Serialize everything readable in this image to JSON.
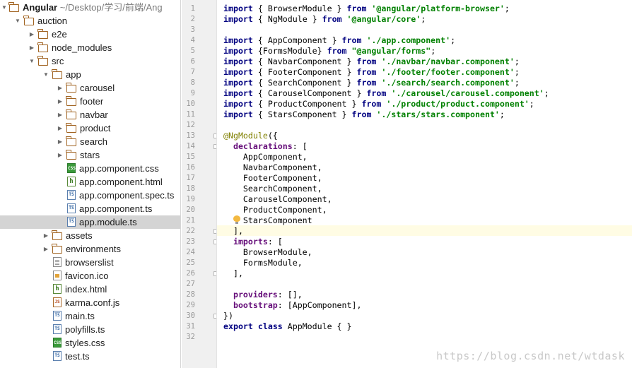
{
  "tree": {
    "project_name": "Angular",
    "project_path": " ~/Desktop/学习/前端/Ang",
    "items": [
      {
        "label": "auction",
        "type": "folder",
        "expanded": true
      },
      {
        "label": "e2e",
        "type": "folder",
        "expanded": false
      },
      {
        "label": "node_modules",
        "type": "folder",
        "expanded": false
      },
      {
        "label": "src",
        "type": "folder",
        "expanded": true
      },
      {
        "label": "app",
        "type": "folder",
        "expanded": true
      },
      {
        "label": "carousel",
        "type": "folder",
        "expanded": false
      },
      {
        "label": "footer",
        "type": "folder",
        "expanded": false
      },
      {
        "label": "navbar",
        "type": "folder",
        "expanded": false
      },
      {
        "label": "product",
        "type": "folder",
        "expanded": false
      },
      {
        "label": "search",
        "type": "folder",
        "expanded": false
      },
      {
        "label": "stars",
        "type": "folder",
        "expanded": false
      },
      {
        "label": "app.component.css",
        "type": "css"
      },
      {
        "label": "app.component.html",
        "type": "html"
      },
      {
        "label": "app.component.spec.ts",
        "type": "ts"
      },
      {
        "label": "app.component.ts",
        "type": "ts"
      },
      {
        "label": "app.module.ts",
        "type": "ts",
        "selected": true
      },
      {
        "label": "assets",
        "type": "folder",
        "expanded": false
      },
      {
        "label": "environments",
        "type": "folder",
        "expanded": false
      },
      {
        "label": "browserslist",
        "type": "plain"
      },
      {
        "label": "favicon.ico",
        "type": "ico"
      },
      {
        "label": "index.html",
        "type": "html"
      },
      {
        "label": "karma.conf.js",
        "type": "js"
      },
      {
        "label": "main.ts",
        "type": "ts"
      },
      {
        "label": "polyfills.ts",
        "type": "ts"
      },
      {
        "label": "styles.css",
        "type": "css"
      },
      {
        "label": "test.ts",
        "type": "ts"
      }
    ]
  },
  "icons": {
    "folder": "folder-icon",
    "css": "css-file-icon",
    "html": "html-file-icon",
    "ts": "typescript-file-icon",
    "js": "javascript-file-icon",
    "plain": "text-file-icon",
    "ico": "image-file-icon",
    "intention": "lightbulb-icon"
  },
  "editor": {
    "current_line": 22,
    "lines": [
      [
        [
          "import",
          "kw"
        ],
        [
          " { BrowserModule } ",
          ""
        ],
        [
          "from",
          "kw"
        ],
        [
          " ",
          ""
        ],
        [
          "'@angular/platform-browser'",
          "str"
        ],
        [
          ";",
          ""
        ]
      ],
      [
        [
          "import",
          "kw"
        ],
        [
          " { NgModule } ",
          ""
        ],
        [
          "from",
          "kw"
        ],
        [
          " ",
          ""
        ],
        [
          "'@angular/core'",
          "str"
        ],
        [
          ";",
          ""
        ]
      ],
      [],
      [
        [
          "import",
          "kw"
        ],
        [
          " { AppComponent } ",
          ""
        ],
        [
          "from",
          "kw"
        ],
        [
          " ",
          ""
        ],
        [
          "'./app.component'",
          "str"
        ],
        [
          ";",
          ""
        ]
      ],
      [
        [
          "import",
          "kw"
        ],
        [
          " {FormsModule} ",
          ""
        ],
        [
          "from",
          "kw"
        ],
        [
          " ",
          ""
        ],
        [
          "\"@angular/forms\"",
          "str"
        ],
        [
          ";",
          ""
        ]
      ],
      [
        [
          "import",
          "kw"
        ],
        [
          " { NavbarComponent } ",
          ""
        ],
        [
          "from",
          "kw"
        ],
        [
          " ",
          ""
        ],
        [
          "'./navbar/navbar.component'",
          "str"
        ],
        [
          ";",
          ""
        ]
      ],
      [
        [
          "import",
          "kw"
        ],
        [
          " { FooterComponent } ",
          ""
        ],
        [
          "from",
          "kw"
        ],
        [
          " ",
          ""
        ],
        [
          "'./footer/footer.component'",
          "str"
        ],
        [
          ";",
          ""
        ]
      ],
      [
        [
          "import",
          "kw"
        ],
        [
          " { SearchComponent } ",
          ""
        ],
        [
          "from",
          "kw"
        ],
        [
          " ",
          ""
        ],
        [
          "'./search/search.component'",
          "str"
        ],
        [
          ";",
          ""
        ]
      ],
      [
        [
          "import",
          "kw"
        ],
        [
          " { CarouselComponent } ",
          ""
        ],
        [
          "from",
          "kw"
        ],
        [
          " ",
          ""
        ],
        [
          "'./carousel/carousel.component'",
          "str"
        ],
        [
          ";",
          ""
        ]
      ],
      [
        [
          "import",
          "kw"
        ],
        [
          " { ProductComponent } ",
          ""
        ],
        [
          "from",
          "kw"
        ],
        [
          " ",
          ""
        ],
        [
          "'./product/product.component'",
          "str"
        ],
        [
          ";",
          ""
        ]
      ],
      [
        [
          "import",
          "kw"
        ],
        [
          " { StarsComponent } ",
          ""
        ],
        [
          "from",
          "kw"
        ],
        [
          " ",
          ""
        ],
        [
          "'./stars/stars.component'",
          "str"
        ],
        [
          ";",
          ""
        ]
      ],
      [],
      [
        [
          "@NgModule",
          "ann"
        ],
        [
          "({",
          ""
        ]
      ],
      [
        [
          "  ",
          ""
        ],
        [
          "declarations",
          "prop"
        ],
        [
          ": [",
          ""
        ]
      ],
      [
        [
          "    AppComponent,",
          ""
        ]
      ],
      [
        [
          "    NavbarComponent,",
          ""
        ]
      ],
      [
        [
          "    FooterComponent,",
          ""
        ]
      ],
      [
        [
          "    SearchComponent,",
          ""
        ]
      ],
      [
        [
          "    CarouselComponent,",
          ""
        ]
      ],
      [
        [
          "    ProductComponent,",
          ""
        ]
      ],
      [
        [
          "    StarsComponent",
          ""
        ]
      ],
      [
        [
          "  ],",
          ""
        ]
      ],
      [
        [
          "  ",
          ""
        ],
        [
          "imports",
          "prop"
        ],
        [
          ": [",
          ""
        ]
      ],
      [
        [
          "    BrowserModule,",
          ""
        ]
      ],
      [
        [
          "    FormsModule,",
          ""
        ]
      ],
      [
        [
          "  ],",
          ""
        ]
      ],
      [],
      [
        [
          "  ",
          ""
        ],
        [
          "providers",
          "prop"
        ],
        [
          ": [],",
          ""
        ]
      ],
      [
        [
          "  ",
          ""
        ],
        [
          "bootstrap",
          "prop"
        ],
        [
          ": [AppComponent],",
          ""
        ]
      ],
      [
        [
          "})",
          ""
        ]
      ],
      [
        [
          "export",
          "kw"
        ],
        [
          " ",
          ""
        ],
        [
          "class",
          "kw"
        ],
        [
          " AppModule { }",
          ""
        ]
      ],
      []
    ],
    "fold_lines": [
      13,
      14,
      22,
      23,
      26,
      30
    ]
  },
  "watermark": "https://blog.csdn.net/wtdask"
}
